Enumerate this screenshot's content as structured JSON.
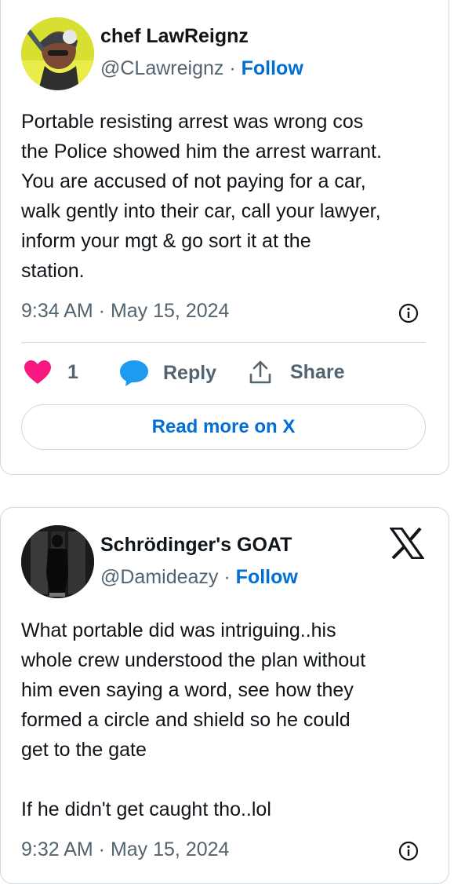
{
  "tweet1": {
    "author_name": "chef LawReignz",
    "handle": "@CLawreignz",
    "separator": "·",
    "follow_label": "Follow",
    "text": "Portable resisting arrest was wrong cos\nthe Police showed him the arrest warrant.\nYou are accused of not paying for a car,\nwalk gently into their car, call your lawyer,\ninform your mgt & go sort it at the\nstation.",
    "timestamp": "9:34 AM · May 15, 2024",
    "like_count": "1",
    "reply_label": "Reply",
    "share_label": "Share",
    "read_more_label": "Read more on X"
  },
  "tweet2": {
    "author_name": "Schrödinger's GOAT",
    "handle": "@Damideazy",
    "separator": "·",
    "follow_label": "Follow",
    "text": "What portable did was intriguing..his\nwhole crew understood the plan without\nhim even saying a word, see how they\nformed a circle and shield so he could\nget to the gate\n\nIf he didn't get caught tho..lol",
    "timestamp": "9:32 AM · May 15, 2024"
  },
  "icons": {
    "heart": "heart-icon",
    "reply": "speech-bubble-icon",
    "share": "share-icon",
    "info": "info-icon",
    "brand": "x-logo-icon"
  },
  "colors": {
    "heart": "#f91880",
    "reply_bubble": "#1d9bf0",
    "link": "#006fd6",
    "muted_text": "#536471",
    "border": "#cfd9de"
  }
}
